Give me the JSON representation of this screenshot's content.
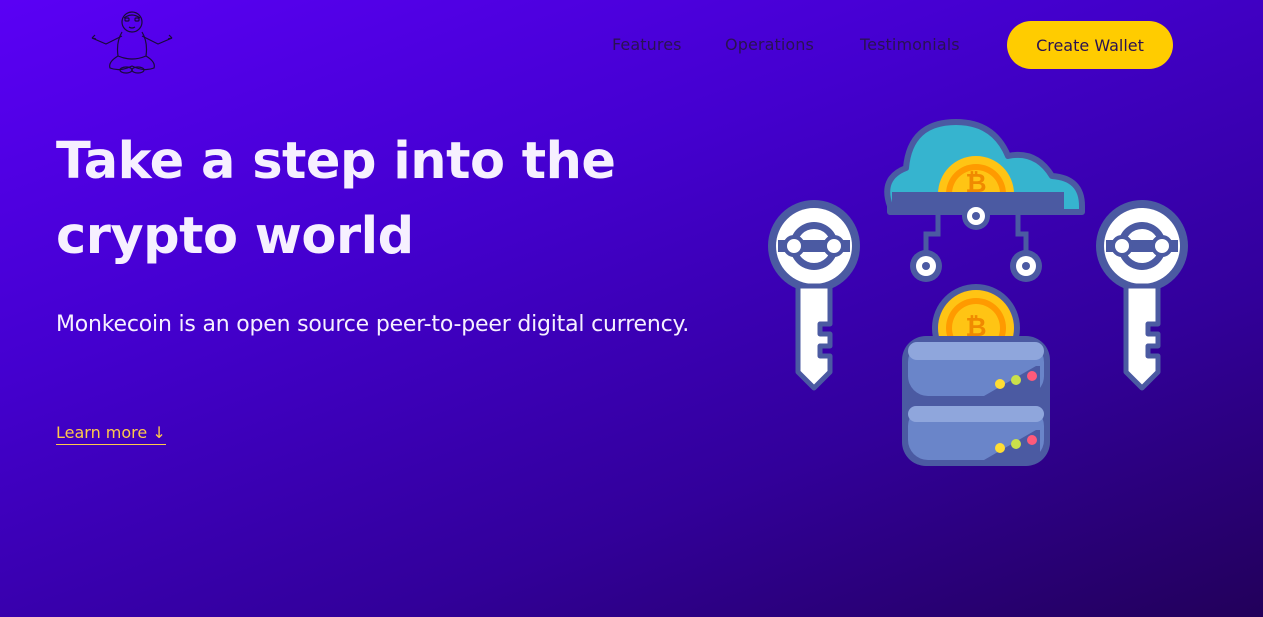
{
  "nav": {
    "links": [
      "Features",
      "Operations",
      "Testimonials"
    ],
    "cta_label": "Create Wallet"
  },
  "hero": {
    "title": "Take a step into the crypto world",
    "subtitle": "Monkecoin is an open source peer-to-peer digital currency.",
    "learn_more": "Learn more ↓"
  },
  "icons": {
    "logo": "meditating-monkey-logo",
    "illustration": "crypto-cloud-keys-server-illustration"
  },
  "colors": {
    "background_start": "#5a00f5",
    "background_end": "#22005a",
    "cta_background": "#ffcc00",
    "accent_link": "#ffc94a",
    "heading_text": "#f6f0ff",
    "nav_text": "#2a1252"
  }
}
